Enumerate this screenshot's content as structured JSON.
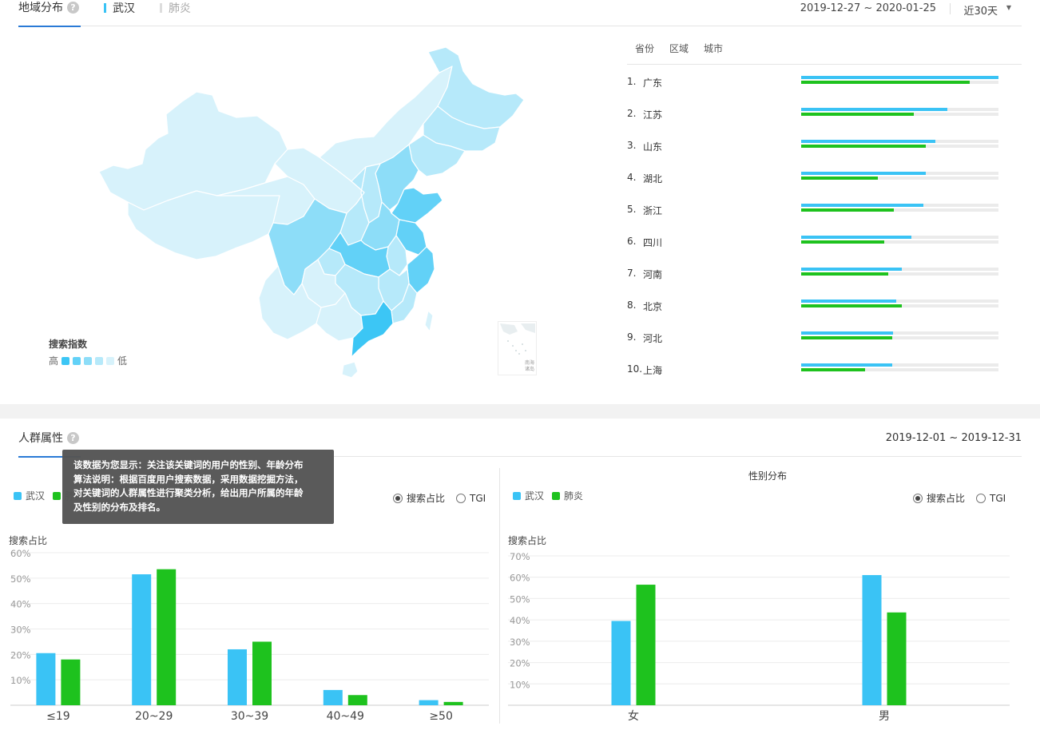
{
  "region": {
    "title": "地域分布",
    "keywords": [
      {
        "label": "武汉",
        "color": "#3ac3f5"
      },
      {
        "label": "肺炎",
        "color": "#dddddd"
      }
    ],
    "date_range": "2019-12-27 ~ 2020-01-25",
    "period": "近30天",
    "legend": {
      "title": "搜索指数",
      "high": "高",
      "low": "低",
      "colors": [
        "#3cc6f5",
        "#62d1f7",
        "#8dddf8",
        "#b6e9fa",
        "#d7f2fb"
      ]
    },
    "nanhai_label": "南海诸岛",
    "rank_tabs": [
      "省份",
      "区域",
      "城市"
    ],
    "ranking": [
      {
        "rank": "1.",
        "name": "广东",
        "wuhan": 1.0,
        "feiyan": 0.855
      },
      {
        "rank": "2.",
        "name": "江苏",
        "wuhan": 0.74,
        "feiyan": 0.57
      },
      {
        "rank": "3.",
        "name": "山东",
        "wuhan": 0.68,
        "feiyan": 0.63
      },
      {
        "rank": "4.",
        "name": "湖北",
        "wuhan": 0.63,
        "feiyan": 0.39
      },
      {
        "rank": "5.",
        "name": "浙江",
        "wuhan": 0.62,
        "feiyan": 0.47
      },
      {
        "rank": "6.",
        "name": "四川",
        "wuhan": 0.56,
        "feiyan": 0.42
      },
      {
        "rank": "7.",
        "name": "河南",
        "wuhan": 0.51,
        "feiyan": 0.44
      },
      {
        "rank": "8.",
        "name": "北京",
        "wuhan": 0.48,
        "feiyan": 0.51
      },
      {
        "rank": "9.",
        "name": "河北",
        "wuhan": 0.465,
        "feiyan": 0.46
      },
      {
        "rank": "10.",
        "name": "上海",
        "wuhan": 0.46,
        "feiyan": 0.325
      }
    ]
  },
  "crowd": {
    "title": "人群属性",
    "date_range": "2019-12-01 ~ 2019-12-31",
    "tooltip": [
      "该数据为您显示：关注该关键词的用户的性别、年龄分布",
      "算法说明：根据百度用户搜索数据，采用数据挖掘方法，",
      "对关键词的人群属性进行聚类分析，给出用户所属的年龄",
      "及性别的分布及排名。"
    ],
    "series_labels": [
      "武汉",
      "肺炎"
    ],
    "series_colors": [
      "#3ac3f5",
      "#1ec21e"
    ],
    "radio_options": [
      "搜索占比",
      "TGI"
    ],
    "gender_title": "性别分布"
  },
  "chart_data": [
    {
      "type": "bar",
      "title": "",
      "ylabel": "搜索占比",
      "ylim": [
        0,
        60
      ],
      "yticks": [
        "60%",
        "50%",
        "40%",
        "30%",
        "20%",
        "10%"
      ],
      "categories": [
        "≤19",
        "20~29",
        "30~39",
        "40~49",
        "≥50"
      ],
      "series": [
        {
          "name": "武汉",
          "values": [
            20.5,
            51.5,
            22,
            6,
            2
          ]
        },
        {
          "name": "肺炎",
          "values": [
            18,
            53.5,
            25,
            4,
            1.3
          ]
        }
      ]
    },
    {
      "type": "bar",
      "title": "性别分布",
      "ylabel": "搜索占比",
      "ylim": [
        0,
        70
      ],
      "yticks": [
        "70%",
        "60%",
        "50%",
        "40%",
        "30%",
        "20%",
        "10%"
      ],
      "categories": [
        "女",
        "男"
      ],
      "series": [
        {
          "name": "武汉",
          "values": [
            39.5,
            61
          ]
        },
        {
          "name": "肺炎",
          "values": [
            56.5,
            43.5
          ]
        }
      ]
    }
  ]
}
